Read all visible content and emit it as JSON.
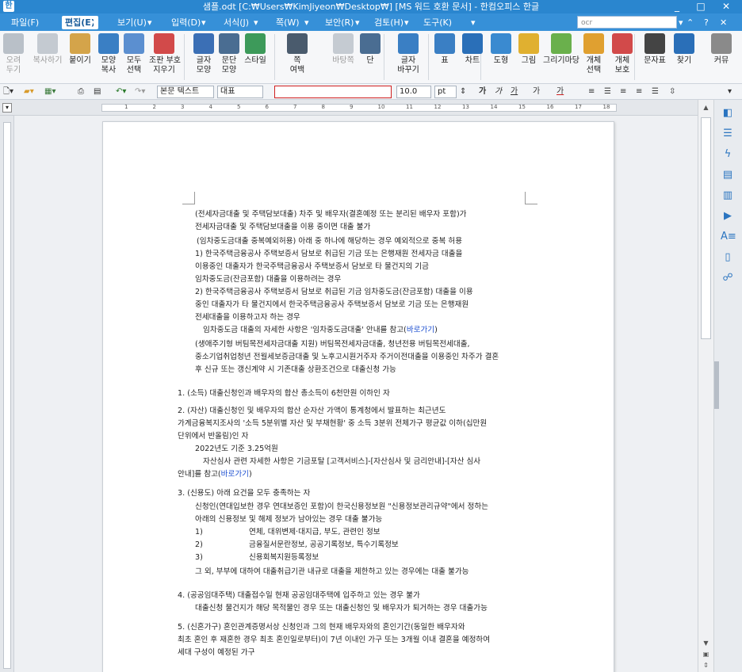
{
  "window": {
    "title": "샘플.odt [C:₩Users₩KimJiyeon₩Desktop₩] [MS 워드 호환 문서] - 한컴오피스 한글",
    "minimize": "_",
    "maximize": "□",
    "close": "✕"
  },
  "menu": {
    "items": [
      "파일(F)",
      "편집(E)",
      "보기(U)",
      "입력(D)",
      "서식(J)",
      "쪽(W)",
      "보안(R)",
      "검토(H)",
      "도구(K)"
    ],
    "active_index": 1,
    "search_value": "ocr",
    "help": "?",
    "close": "✕"
  },
  "ribbon": {
    "buttons": [
      {
        "label": "오려\n두기",
        "icon": "scissors-icon",
        "color": "#b9c0c8",
        "disabled": true
      },
      {
        "label": "복사하기",
        "icon": "copy-icon",
        "color": "#c4cad1",
        "disabled": true
      },
      {
        "label": "붙이기",
        "icon": "paste-icon",
        "color": "#d4a44a",
        "disabled": false
      },
      {
        "label": "모양\n복사",
        "icon": "format-painter-icon",
        "color": "#3a7fc4",
        "disabled": false
      },
      {
        "label": "모두\n선택",
        "icon": "select-all-icon",
        "color": "#5b8fd0",
        "disabled": false
      },
      {
        "label": "조판 부호\n지우기",
        "icon": "clear-codes-icon",
        "color": "#d24a4a",
        "disabled": false
      },
      {
        "label": "글자\n모양",
        "icon": "char-shape-icon",
        "color": "#3b6fb5",
        "disabled": false
      },
      {
        "label": "문단\n모양",
        "icon": "para-shape-icon",
        "color": "#4a6d92",
        "disabled": false
      },
      {
        "label": "스타일",
        "icon": "style-icon",
        "color": "#3d9a5a",
        "disabled": false
      },
      {
        "label": "쪽\n여백",
        "icon": "page-margin-icon",
        "color": "#4a5b6d",
        "disabled": false
      },
      {
        "label": "바탕쪽",
        "icon": "master-page-icon",
        "color": "#c5cbd2",
        "disabled": true
      },
      {
        "label": "단",
        "icon": "columns-icon",
        "color": "#4a6d92",
        "disabled": false
      },
      {
        "label": "글자\n바꾸기",
        "icon": "replace-char-icon",
        "color": "#3a7fc4",
        "disabled": false
      },
      {
        "label": "표",
        "icon": "table-icon",
        "color": "#3a7fc4",
        "disabled": false
      },
      {
        "label": "차트",
        "icon": "chart-icon",
        "color": "#2a6fb8",
        "disabled": false
      },
      {
        "label": "도형",
        "icon": "shape-icon",
        "color": "#3a8ad0",
        "disabled": false
      },
      {
        "label": "그림",
        "icon": "picture-icon",
        "color": "#e0b030",
        "disabled": false
      },
      {
        "label": "그리기마당",
        "icon": "clipart-icon",
        "color": "#6ab04c",
        "disabled": false
      },
      {
        "label": "개체\n선택",
        "icon": "object-select-icon",
        "color": "#e0a030",
        "disabled": false
      },
      {
        "label": "개체\n보호",
        "icon": "object-protect-icon",
        "color": "#d24a4a",
        "disabled": false
      },
      {
        "label": "문자표",
        "icon": "symbol-icon",
        "color": "#444444",
        "disabled": false
      },
      {
        "label": "찾기",
        "icon": "find-icon",
        "color": "#2a6fb8",
        "disabled": false
      },
      {
        "label": "커뮤",
        "icon": "community-icon",
        "color": "#8a8a8a",
        "disabled": false
      }
    ]
  },
  "toolbar2": {
    "style": "본문 텍스트",
    "language": "대표",
    "font": "",
    "size": "10.0",
    "unit": "pt",
    "bold": "가",
    "italic": "가",
    "underline": "가",
    "strike": "가",
    "color": "가"
  },
  "ruler": {
    "ticks": [
      "1",
      "2",
      "3",
      "4",
      "5",
      "6",
      "7",
      "8",
      "9",
      "10",
      "11",
      "12",
      "13",
      "14",
      "15",
      "16",
      "17",
      "18"
    ]
  },
  "document": {
    "lines": [
      "(전세자금대출 및 주택담보대출) 차주 및 배우자(결혼예정 또는 분리된 배우자 포함)가",
      "전세자금대출 및 주택담보대출을 이용 중이면 대출 불가",
      "(임차중도금대출 중복예외허용) 아래 중 하나에 해당하는 경우 예외적으로 중복 허용",
      "1)          한국주택금융공사 주택보증서 담보로 취급된 기금 또는 은행재원 전세자금 대출을",
      "이용중인 대출자가 한국주택금융공사 주택보증서 담보로 타 물건지의 기금",
      "임차중도금(잔금포함) 대출을 이용하려는 경우",
      "2)          한국주택금융공사 주택보증서 담보로 취급된 기금 임차중도금(잔금포함) 대출을 이용",
      "중인 대출자가 타 물건지에서 한국주택금융공사 주택보증서 담보로 기금 또는 은행재원",
      "전세대출을 이용하고자 하는 경우",
      "임차중도금 대출의 자세한 사항은 '임차중도금대출' 안내를 참고(",
      "(생애주기형 버팀목전세자금대출 지원) 버팀목전세자금대출, 청년전용 버팀목전세대출,",
      "중소기업취업청년 전월세보증금대출 및 노후고시원거주자 주거이전대출을 이용중인 차주가 결혼",
      "후 신규 또는 갱신계약 시 기존대출 상환조건으로 대출신청 가능",
      "1.          (소득) 대출신청인과 배우자의 합산 총소득이 6천만원 이하인 자",
      "2.          (자산) 대출신청인 및 배우자의 합산 순자산 가액이 통계청에서 발표하는 최근년도",
      "가계금융복지조사의 '소득 5분위별 자산 및 부채현황' 중 소득 3분위 전체가구 평균값 이하(십만원",
      "단위에서 반올림)인 자",
      "2022년도 기준 3.25억원",
      "자산심사 관련 자세한 사항은 기금포탈 [고객서비스]-[자산심사 및 금리안내]-[자산 심사",
      "안내]를 참고(",
      "3.          (신용도) 아래 요건을 모두 충족하는 자",
      "신청인(연대입보한 경우 연대보증인 포함)이 한국신용정보원 \"신용정보관리규약\"에서 정하는",
      "아래의 신용정보 및 해제 정보가 남아있는 경우 대출 불가능",
      "1)",
      "연체, 대위변제·대지급, 부도, 관련인 정보",
      "2)",
      "금융질서문란정보, 공공기록정보, 특수기록정보",
      "3)",
      "신용회복지원등록정보",
      "그 외, 부부에 대하여 대출취급기관 내규로 대출을 제한하고 있는 경우에는 대출 불가능",
      "4.          (공공임대주택) 대출접수일 현재 공공임대주택에 입주하고 있는 경우 불가",
      "대출신청 물건지가 해당 목적물인 경우 또는 대출신청인 및 배우자가 퇴거하는 경우 대출가능",
      "5.          (신혼가구) 혼인관계증명서상 신청인과 그의 현재 배우자와의 혼인기간(동일한 배우자와",
      "최초 혼인 후 재혼한 경우 최초 혼인일로부터)이 7년 이내인 가구 또는 3개월 이내 결혼을 예정하여",
      "세대 구성이 예정된 가구"
    ],
    "link_text": "바로가기",
    "link_close": ")"
  }
}
